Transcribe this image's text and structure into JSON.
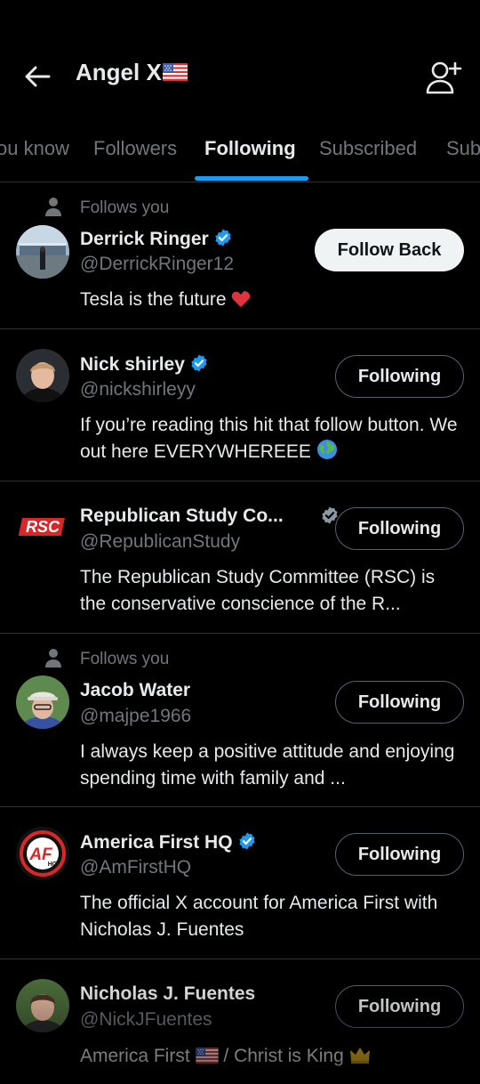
{
  "header": {
    "title": "Angel X",
    "back_icon": "arrow-left-icon",
    "add_icon": "add-person-icon"
  },
  "tabs": [
    {
      "label": "ou know"
    },
    {
      "label": "Followers"
    },
    {
      "label": "Following",
      "active": true
    },
    {
      "label": "Subscribed"
    },
    {
      "label": "Sub"
    }
  ],
  "colors": {
    "accent": "#1d9bf0",
    "background": "#000000",
    "muted": "#71767b",
    "text": "#e7e9ea"
  },
  "follows_you_label": "Follows you",
  "users": [
    {
      "name": "Derrick Ringer",
      "handle": "@DerrickRinger12",
      "bio": "Tesla is the future",
      "verified": true,
      "follows_you": true,
      "button": "Follow Back"
    },
    {
      "name": "Nick shirley",
      "handle": "@nickshirleyy",
      "bio": "If you’re reading this hit that follow button. We out here EVERYWHEREEE",
      "verified": true,
      "follows_you": false,
      "button": "Following"
    },
    {
      "name": "Republican Study Co...",
      "handle": "@RepublicanStudy",
      "bio": "The Republican Study Committee (RSC) is the conservative conscience of the R...",
      "verified": true,
      "follows_you": false,
      "button": "Following",
      "logo_text": "RSC"
    },
    {
      "name": "Jacob Water",
      "handle": "@majpe1966",
      "bio": "I always keep a positive attitude and enjoying spending time with family and ...",
      "verified": false,
      "follows_you": true,
      "button": "Following"
    },
    {
      "name": "America First HQ",
      "handle": "@AmFirstHQ",
      "bio": "The official X account for America First with Nicholas J. Fuentes",
      "verified": true,
      "follows_you": false,
      "button": "Following",
      "logo_text": "AF",
      "logo_sub": "HQ"
    },
    {
      "name": "Nicholas J. Fuentes",
      "handle": "@NickJFuentes",
      "bio_part1": "America First",
      "bio_sep": "/",
      "bio_part2": "Christ is King",
      "verified": false,
      "follows_you": false,
      "button": "Following"
    }
  ]
}
